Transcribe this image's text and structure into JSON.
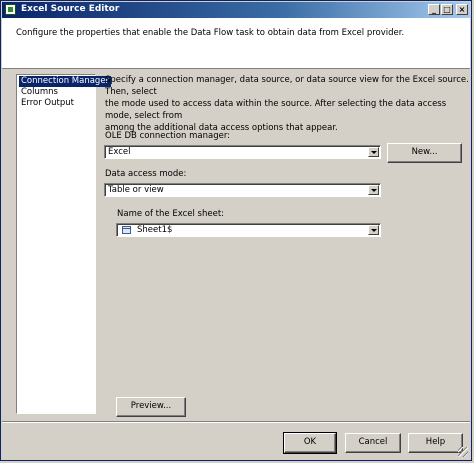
{
  "window": {
    "title": "Excel Source Editor",
    "controls": [
      "_",
      "□",
      "×"
    ]
  },
  "header": {
    "description": "Configure the properties that enable the Data Flow task to obtain data from Excel provider."
  },
  "nav": {
    "items": [
      {
        "label": "Connection Manager",
        "selected": true
      },
      {
        "label": "Columns",
        "selected": false
      },
      {
        "label": "Error Output",
        "selected": false
      }
    ]
  },
  "main": {
    "intro": [
      "Specify a connection manager, data source, or data source view for the Excel source. Then, select",
      "the mode used to access data within the source. After selecting the data access mode, select from",
      "among the additional data access options that appear."
    ],
    "connection_label": "OLE DB connection manager:",
    "connection_value": "Excel",
    "new_button": "New...",
    "access_mode_label": "Data access mode:",
    "access_mode_value": "Table or view",
    "sheet_label": "Name of the Excel sheet:",
    "sheet_value": "Sheet1$",
    "preview_button": "Preview..."
  },
  "footer": {
    "ok": "OK",
    "cancel": "Cancel",
    "help": "Help"
  }
}
